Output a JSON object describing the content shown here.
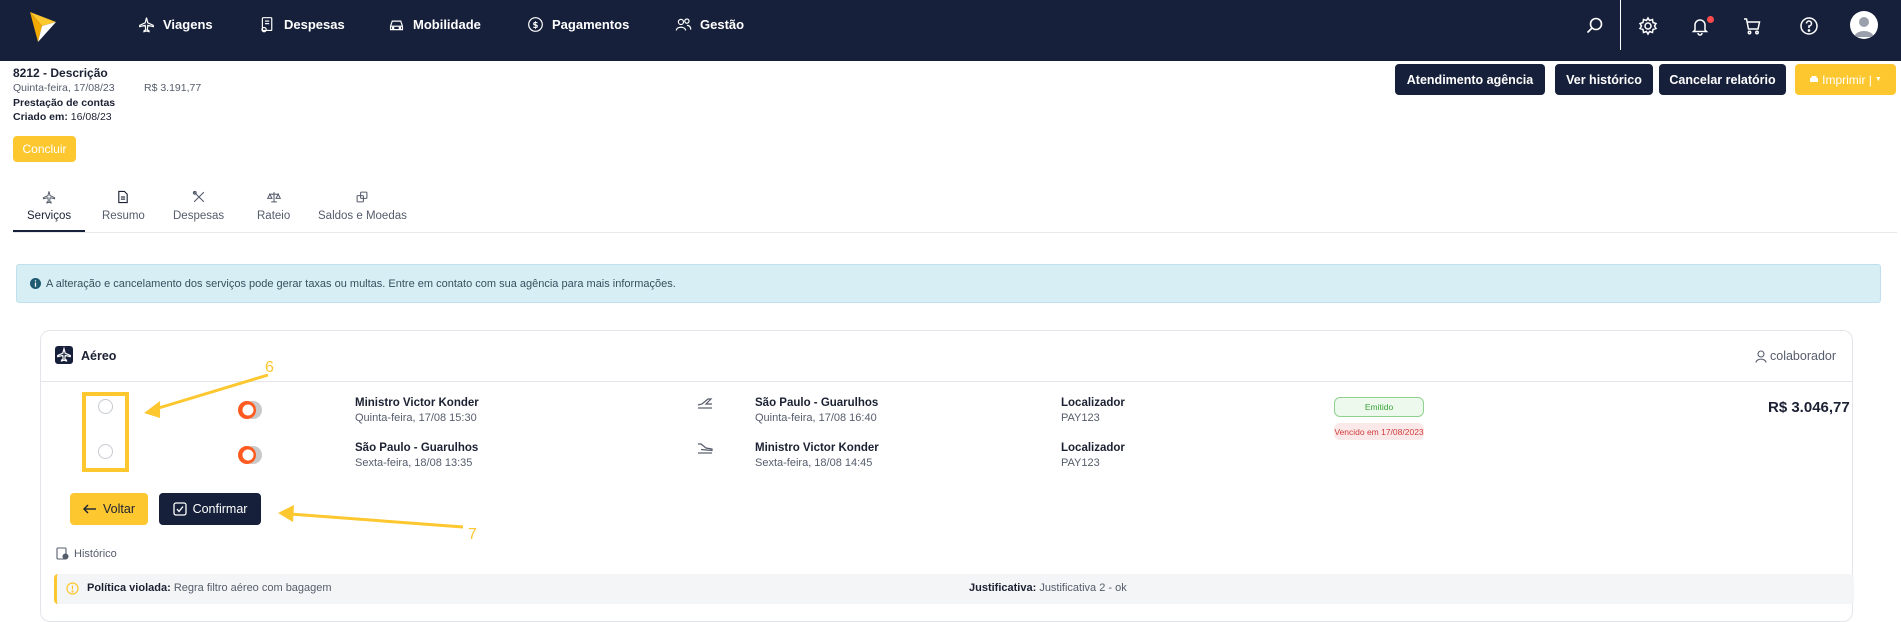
{
  "nav": {
    "items": [
      {
        "label": "Viagens",
        "icon": "plane-icon"
      },
      {
        "label": "Despesas",
        "icon": "receipt-icon"
      },
      {
        "label": "Mobilidade",
        "icon": "car-icon"
      },
      {
        "label": "Pagamentos",
        "icon": "dollar-icon"
      },
      {
        "label": "Gestão",
        "icon": "users-icon"
      }
    ],
    "right_icons": [
      "search-icon",
      "gear-icon",
      "bell-icon",
      "cart-icon",
      "help-icon",
      "avatar"
    ]
  },
  "report": {
    "title": "8212 - Descrição",
    "date": "Quinta-feira, 17/08/23",
    "total": "R$ 3.191,77",
    "type": "Prestação de contas",
    "created_label": "Criado em:",
    "created_value": "16/08/23",
    "conclude_label": "Concluir"
  },
  "actions": {
    "agency": "Atendimento agência",
    "history": "Ver histórico",
    "cancel": "Cancelar relatório",
    "print": "Imprimir |"
  },
  "tabs": [
    {
      "label": "Serviços",
      "icon": "plane-icon",
      "active": true
    },
    {
      "label": "Resumo",
      "icon": "document-icon",
      "active": false
    },
    {
      "label": "Despesas",
      "icon": "tools-icon",
      "active": false
    },
    {
      "label": "Rateio",
      "icon": "scale-icon",
      "active": false
    },
    {
      "label": "Saldos e Moedas",
      "icon": "coins-icon",
      "active": false
    }
  ],
  "alert": {
    "text": "A alteração e cancelamento dos serviços pode gerar taxas ou multas. Entre em contato com sua agência para mais informações."
  },
  "card": {
    "title": "Aéreo",
    "collaborator": "colaborador",
    "flights": [
      {
        "origin": "Ministro Victor Konder",
        "origin_time": "Quinta-feira, 17/08 15:30",
        "destination": "São Paulo - Guarulhos",
        "destination_time": "Quinta-feira, 17/08 16:40",
        "locator_label": "Localizador",
        "locator": "PAY123"
      },
      {
        "origin": "São Paulo - Guarulhos",
        "origin_time": "Sexta-feira, 18/08 13:35",
        "destination": "Ministro Victor Konder",
        "destination_time": "Sexta-feira, 18/08 14:45",
        "locator_label": "Localizador",
        "locator": "PAY123"
      }
    ],
    "status_issued": "Emitido",
    "status_expired": "Vencido em 17/08/2023",
    "price": "R$ 3.046,77",
    "back_label": "Voltar",
    "confirm_label": "Confirmar",
    "history_label": "Histórico",
    "policy_label": "Política violada:",
    "policy_value": "Regra filtro aéreo com bagagem",
    "justification_label": "Justificativa:",
    "justification_value": "Justificativa 2 - ok"
  },
  "annotations": {
    "step_6": "6",
    "step_7": "7"
  },
  "colors": {
    "navy": "#16203a",
    "yellow": "#fcc72f",
    "alert_bg": "#d8eef5",
    "issued": "#3aa53a",
    "expired": "#d13b3b"
  }
}
